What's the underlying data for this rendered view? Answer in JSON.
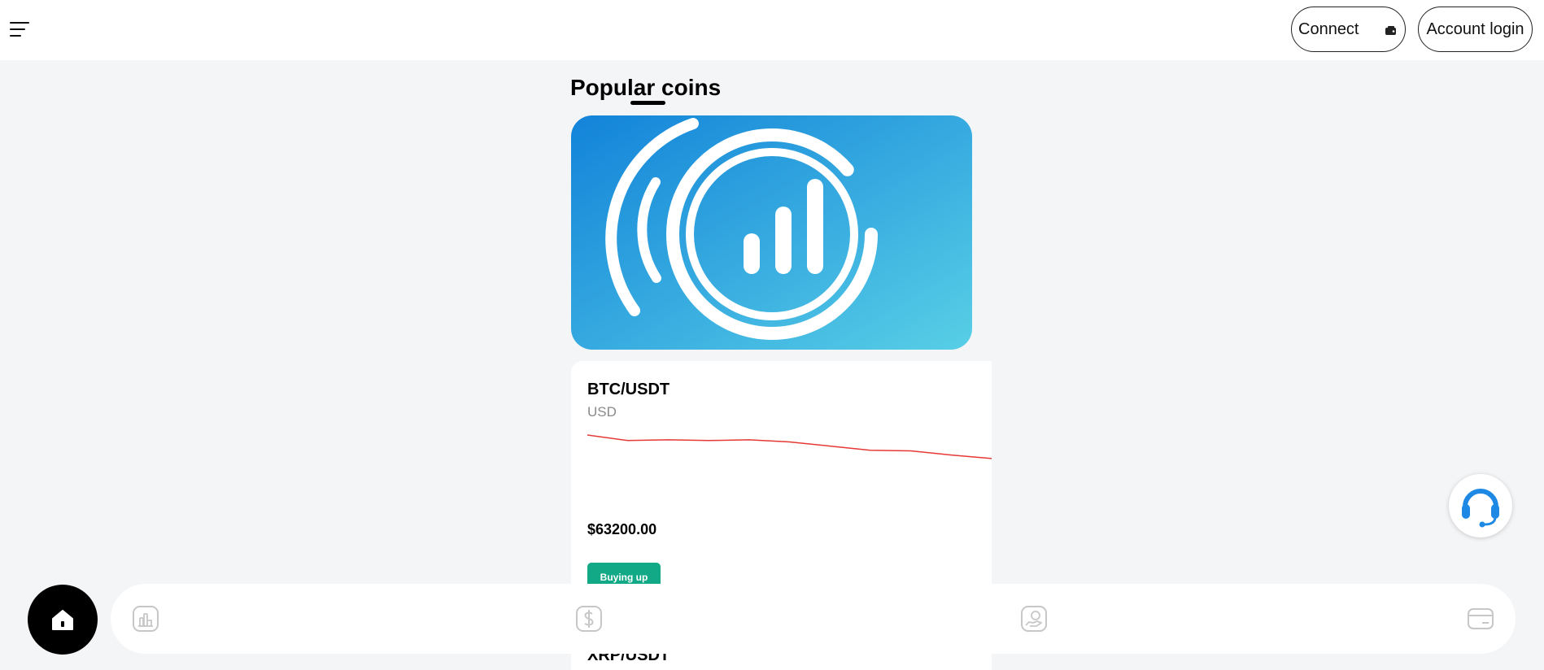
{
  "header": {
    "menu_icon": "hamburger-menu-icon",
    "connect_label": "Connect",
    "connect_icon": "wallet-icon",
    "login_label": "Account login"
  },
  "section": {
    "title": "Popular coins"
  },
  "banner": {
    "icon": "coin-chart-logo",
    "gradient_start": "#1283d9",
    "gradient_end": "#58cfe6"
  },
  "coins": [
    {
      "pair": "BTC/USDT",
      "quote_currency": "USD",
      "price": "$63200.00",
      "action_label": "Buying up",
      "trend_color": "#e53935",
      "trend": [
        20,
        28,
        27,
        28,
        27,
        30,
        36,
        42,
        43,
        49,
        54
      ]
    },
    {
      "pair": "XRP/USDT"
    }
  ],
  "colors": {
    "accent_green": "#12a986",
    "support_blue": "#1e88e5"
  },
  "floating": {
    "support_icon": "headset-support-icon",
    "home_icon": "home-icon"
  },
  "bottom_nav": {
    "items": [
      {
        "icon": "market-chart-icon"
      },
      {
        "icon": "dollar-icon"
      },
      {
        "icon": "hand-money-icon"
      },
      {
        "icon": "card-icon"
      }
    ]
  }
}
